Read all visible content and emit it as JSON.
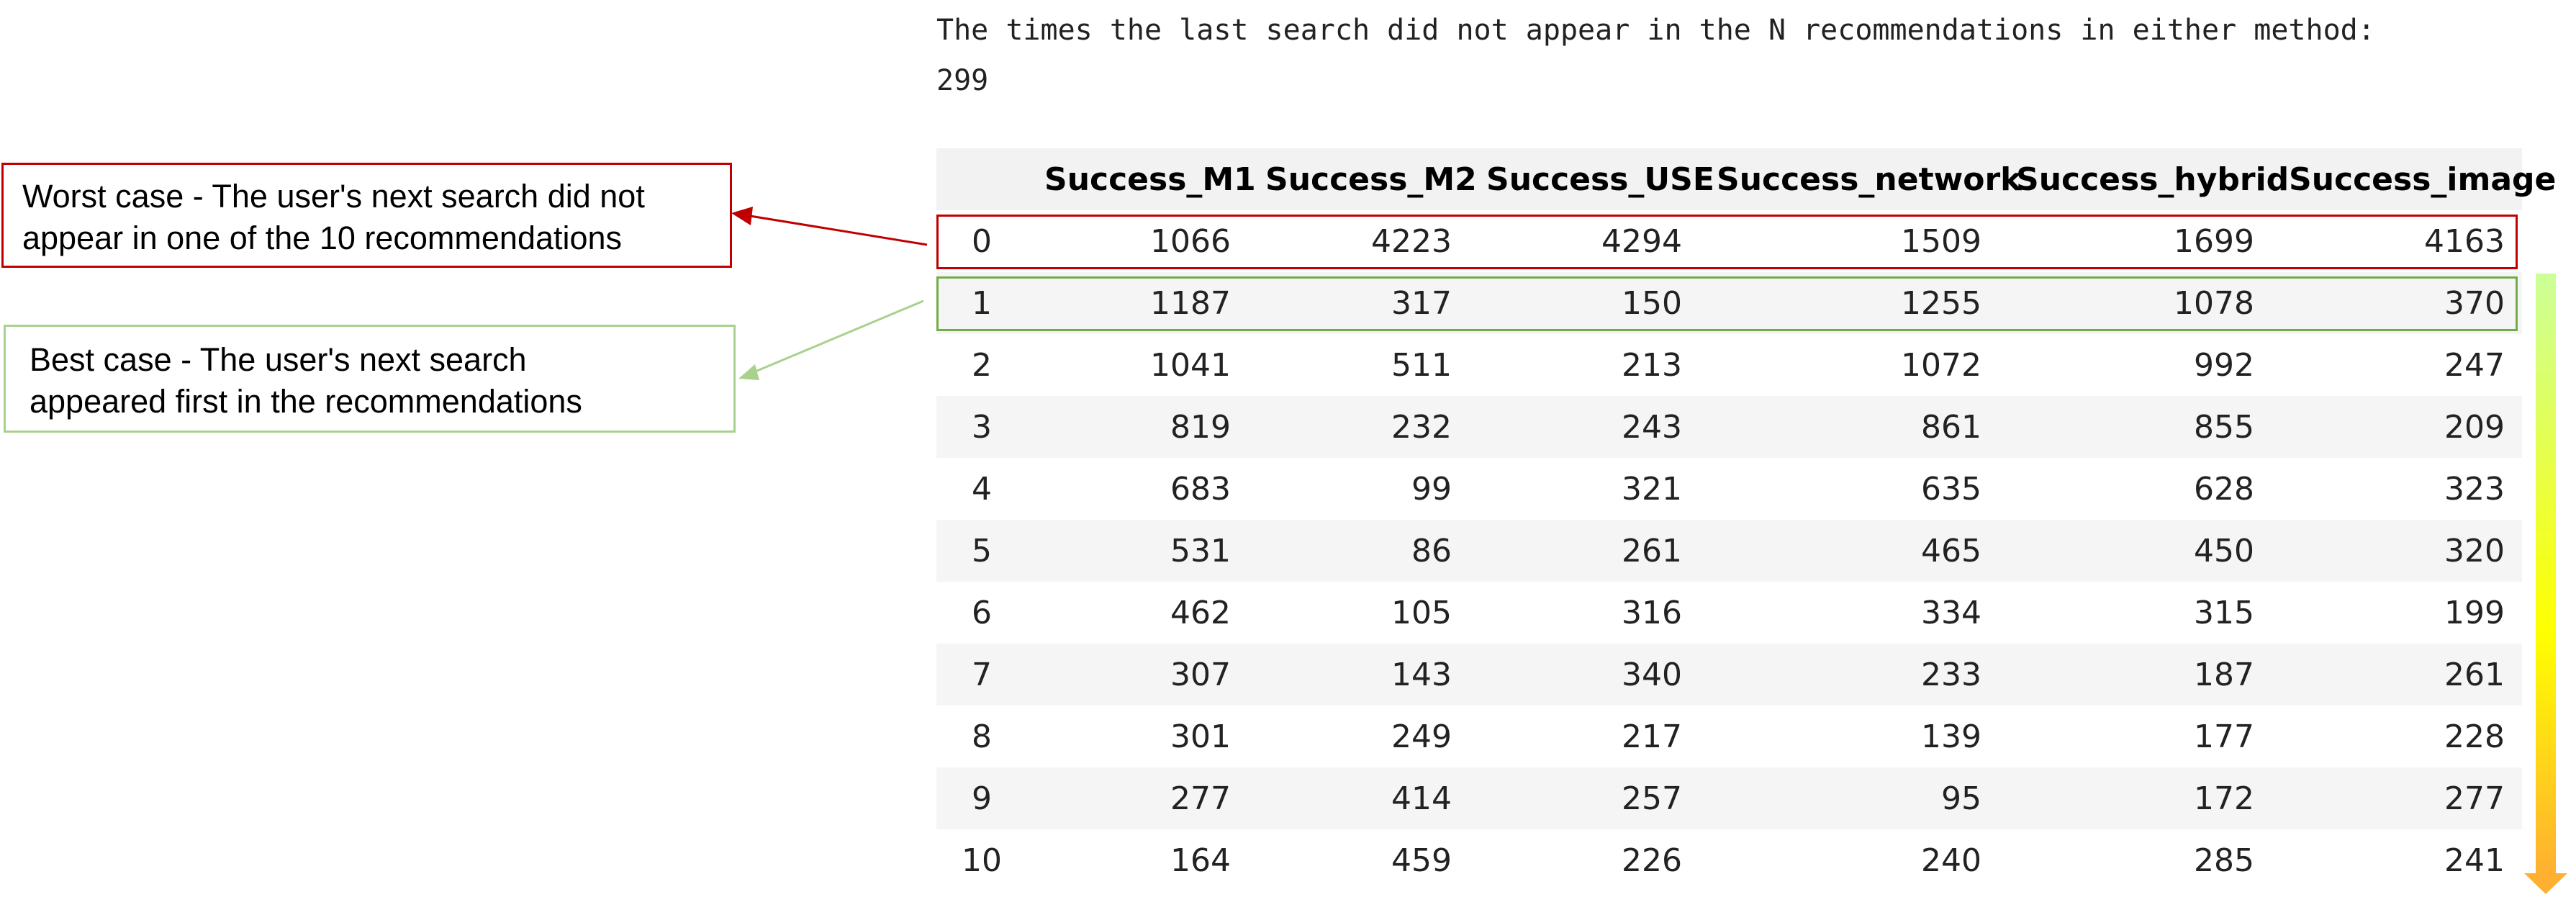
{
  "output": {
    "line1": "The times the last search did not appear in the N recommendations in either method:",
    "line2": "299"
  },
  "callouts": {
    "worst": {
      "line1": "Worst case - The user's next search did not",
      "line2": "appear in one of the 10 recommendations"
    },
    "best": {
      "line1": "Best case - The user's next search",
      "line2": "appeared first in the recommendations"
    }
  },
  "table": {
    "columns": [
      "",
      "Success_M1",
      "Success_M2",
      "Success_USE",
      "Success_network",
      "Success_hybrid",
      "Success_image"
    ],
    "rows": [
      [
        "0",
        "1066",
        "4223",
        "4294",
        "1509",
        "1699",
        "4163"
      ],
      [
        "1",
        "1187",
        "317",
        "150",
        "1255",
        "1078",
        "370"
      ],
      [
        "2",
        "1041",
        "511",
        "213",
        "1072",
        "992",
        "247"
      ],
      [
        "3",
        "819",
        "232",
        "243",
        "861",
        "855",
        "209"
      ],
      [
        "4",
        "683",
        "99",
        "321",
        "635",
        "628",
        "323"
      ],
      [
        "5",
        "531",
        "86",
        "261",
        "465",
        "450",
        "320"
      ],
      [
        "6",
        "462",
        "105",
        "316",
        "334",
        "315",
        "199"
      ],
      [
        "7",
        "307",
        "143",
        "340",
        "233",
        "187",
        "261"
      ],
      [
        "8",
        "301",
        "249",
        "217",
        "139",
        "177",
        "228"
      ],
      [
        "9",
        "277",
        "414",
        "257",
        "95",
        "172",
        "277"
      ],
      [
        "10",
        "164",
        "459",
        "226",
        "240",
        "285",
        "241"
      ]
    ]
  },
  "colors": {
    "worst": "#c00000",
    "best": "#70ad47",
    "best_callout_border": "#a9d18e",
    "gradient_top": "#ccff99",
    "gradient_mid": "#ffff00",
    "gradient_bottom": "#ffb030"
  }
}
